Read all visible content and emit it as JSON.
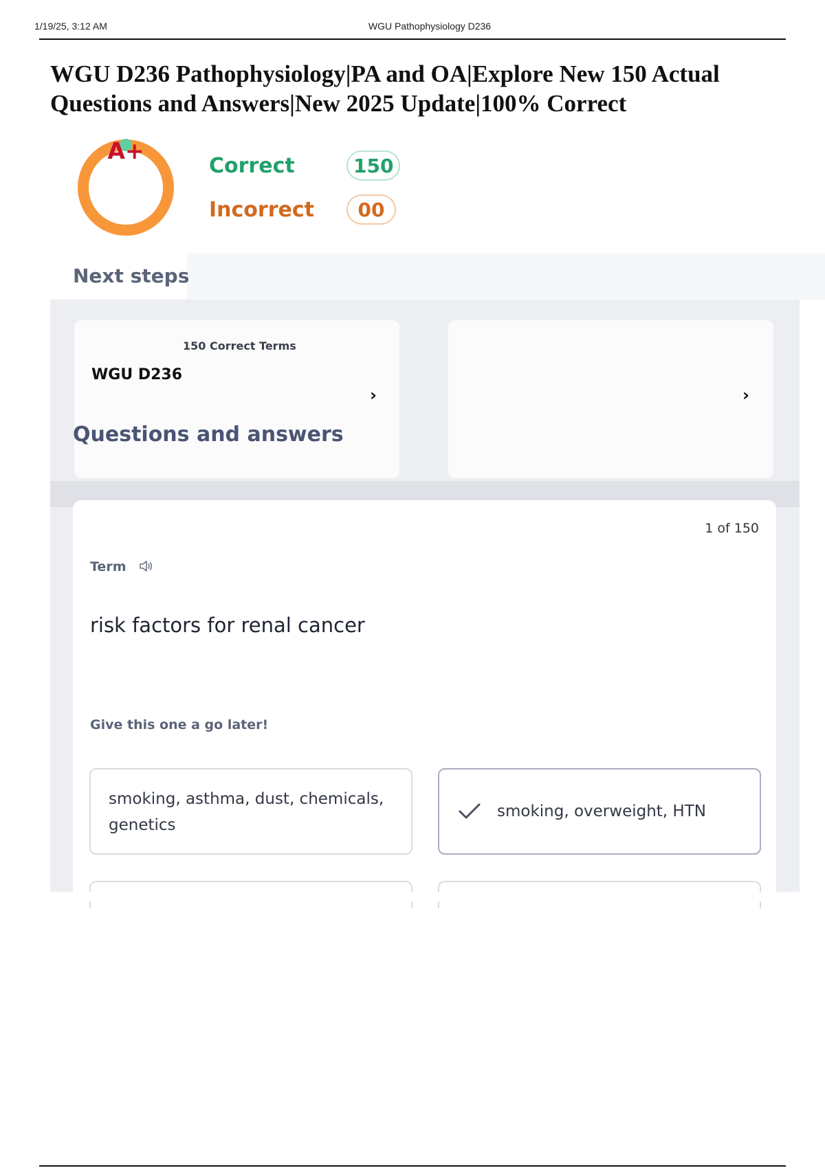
{
  "print_header": {
    "timestamp": "1/19/25, 3:12 AM",
    "title": "WGU Pathophysiology D236"
  },
  "document": {
    "heading": "WGU D236 Pathophysiology|PA and OA|Explore New 150 Actual Questions and Answers|New 2025 Update|100% Correct"
  },
  "score": {
    "grade": "A+",
    "correct_label": "Correct",
    "correct_count": "150",
    "incorrect_label": "Incorrect",
    "incorrect_count": "00",
    "ring_color": "#f7973a",
    "ring_marker_color": "#5fd1a0"
  },
  "next_steps": {
    "heading": "Next steps",
    "set_card": {
      "count": "150 Correct Terms",
      "name": "WGU D236",
      "chevron": "›"
    },
    "blank_card": {
      "chevron": "›"
    },
    "section_title": "Questions and answers"
  },
  "flashcard": {
    "progress": "1 of 150",
    "term_label": "Term",
    "speaker_icon": "speaker-icon",
    "term": "risk factors for renal cancer",
    "later_prompt": "Give this one a go later!",
    "options": [
      {
        "text": "smoking, asthma, dust, chemicals, genetics",
        "selected": false
      },
      {
        "text": "smoking, overweight, HTN",
        "selected": true
      }
    ]
  }
}
